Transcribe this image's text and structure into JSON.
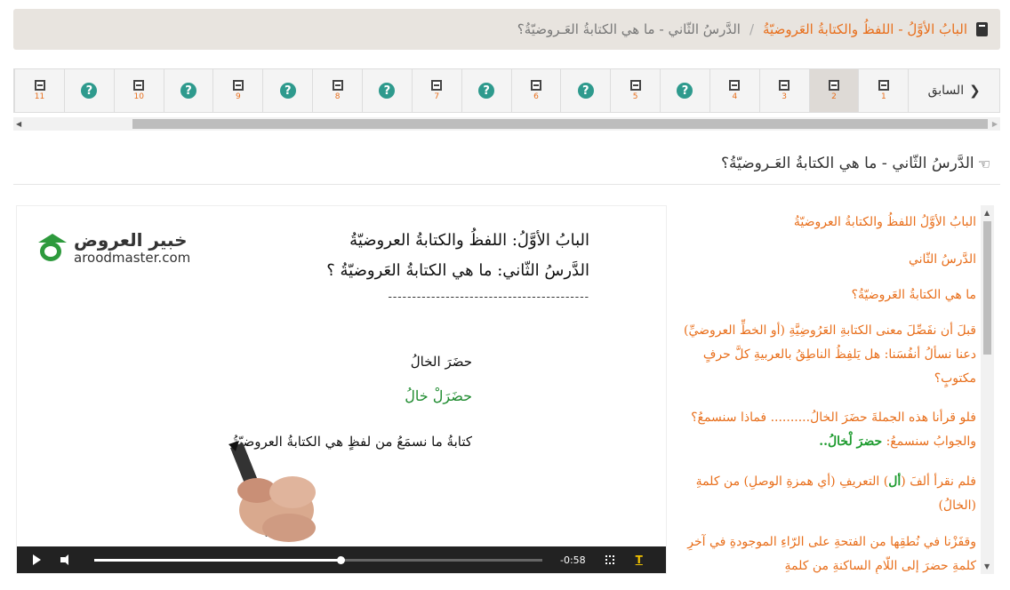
{
  "breadcrumb": {
    "link": "البابُ الأوَّلُ - اللفظُ والكتابةُ العَروضيّةُ",
    "separator": "/",
    "current": "الدَّرسُ الثّاني - ما هي الكتابةُ العَـروضيّةُ؟"
  },
  "nav": {
    "prev_label": "السابق",
    "items": [
      {
        "icon": "film-icon",
        "number": "1"
      },
      {
        "icon": "film-icon",
        "number": "2",
        "active": true
      },
      {
        "icon": "film-icon",
        "number": "3"
      },
      {
        "icon": "film-icon",
        "number": "4"
      },
      {
        "icon": "question-icon",
        "symbol": "?"
      },
      {
        "icon": "film-icon",
        "number": "5"
      },
      {
        "icon": "question-icon",
        "symbol": "?"
      },
      {
        "icon": "film-icon",
        "number": "6"
      },
      {
        "icon": "question-icon",
        "symbol": "?"
      },
      {
        "icon": "film-icon",
        "number": "7"
      },
      {
        "icon": "question-icon",
        "symbol": "?"
      },
      {
        "icon": "film-icon",
        "number": "8"
      },
      {
        "icon": "question-icon",
        "symbol": "?"
      },
      {
        "icon": "film-icon",
        "number": "9"
      },
      {
        "icon": "question-icon",
        "symbol": "?"
      },
      {
        "icon": "film-icon",
        "number": "10"
      },
      {
        "icon": "question-icon",
        "symbol": "?"
      },
      {
        "icon": "film-icon",
        "number": "11"
      }
    ]
  },
  "lesson": {
    "title": "الدَّرسُ الثّاني - ما هي الكتابةُ العَـروضيّةُ؟"
  },
  "video": {
    "logo_ar": "خبير العروض",
    "logo_en": "aroodmaster.com",
    "line_bab": "البابُ الأوَّلُ:  اللفظُ والكتابةُ العروضيّةُ",
    "line_dars": "الدَّرسُ الثّاني:  ما هي الكتابةُ العَروضيّةُ ؟",
    "dashes": "------------------------------------------",
    "hadara": "حضَرَ الخالُ",
    "hadara_arudi": "حضَرَلْ خالُ",
    "kitaba": "كتابةُ ما نسمَعُ من لفظٍ هي الكتابةُ العروضيّةُ",
    "time": "-0:58",
    "progress": 0.55,
    "cc_label": "T"
  },
  "panel": {
    "p1": "البابُ الأوَّلُ    اللفظُ والكتابةُ العروضيّةُ",
    "p2": "الدَّرسُ الثّاني",
    "p3": "ما هي الكتابةُ العَروضيّةُ؟",
    "p4": "قبلَ أن نفَصِّلَ معنى الكتابةِ العَرُوضِيَّةِ (أو الخطِّ العروضيِّ) دعنا نسألُ أنفُسَنا: هل يَلفِظُ الناطِقُ بالعربيةِ كلَّ حرفٍ مكتوبٍ؟",
    "p5a": "فلو قرأنا هذه الجملةَ حضَرَ الخالُ.......... فماذا سنسمعُ؟ والجوابُ سنسمعُ: ",
    "p5b": "حضرَ لْخالُ..",
    "p6a": "فلم نقرأ ألفَ (",
    "p6b": "أل",
    "p6c": ") التعريفِ (أي همزةِ الوصلِ) من كلمةِ (الخالُ)",
    "p7": "وقفَزْنا في نُطقِها من الفتحةِ على الرّاءِ الموجودةِ في آخرِ كلمةِ حضرَ إلى اللّامِ الساكنةِ من كلمةِ"
  }
}
